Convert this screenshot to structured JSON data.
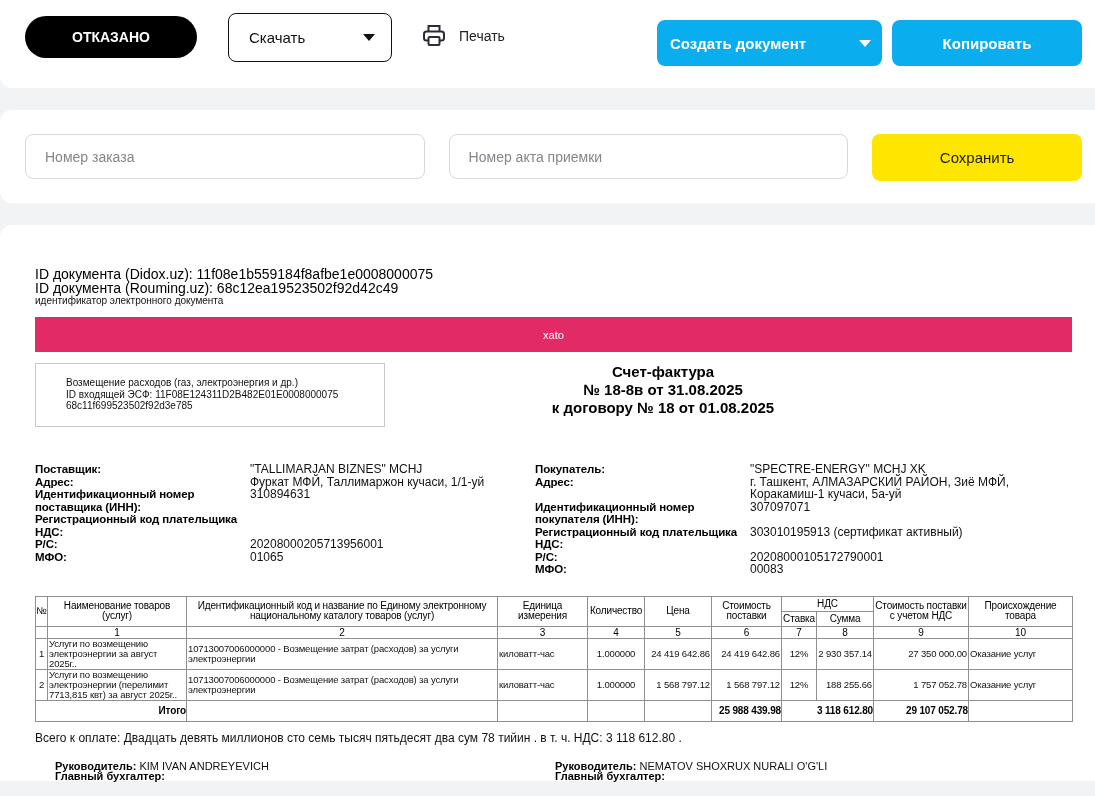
{
  "toolbar": {
    "status": {
      "label": "ОТКАЗАНО"
    },
    "download": {
      "label": "Скачать"
    },
    "print": {
      "label": "Печать"
    },
    "create": {
      "label": "Создать документ"
    },
    "copy": {
      "label": "Копировать"
    }
  },
  "form": {
    "fields": [
      {
        "placeholder": "Номер заказа"
      },
      {
        "placeholder": "Номер акта приемки"
      }
    ],
    "save": {
      "label": "Сохранить"
    }
  },
  "document": {
    "ids": [
      "ID документа (Didox.uz): 11f08e1b559184f8afbe1e0008000075",
      "ID документа (Rouming.uz): 68c12ea19523502f92d42c49"
    ],
    "id_caption": "идентификатор электронного документа",
    "banner": "xato",
    "info_box": [
      "Возмещение расходов (газ, электроэнергия и др.)",
      "ID входящей ЭСФ: 11F08E124311D2B482E01E0008000075",
      "68c11f699523502f92d3e785"
    ],
    "title": [
      "Счет-фактура",
      "№ 18-8в от 31.08.2025",
      "к договору № 18 от 01.08.2025"
    ],
    "parties": [
      {
        "rows": [
          {
            "label": "Поставщик:",
            "value": "\"TALLIMARJAN BIZNES\" MCHJ"
          },
          {
            "label": "Адрес:",
            "value": "Фуркат МФЙ, Таллимаржон кучаси, 1/1-уй"
          },
          {
            "label": "Идентификационный номер поставщика (ИНН):",
            "value": "310894631"
          },
          {
            "label": "Регистрационный код плательщика НДС:"
          },
          {
            "label": "Р/С:",
            "value": "20208000205713956001"
          },
          {
            "label": "МФО:",
            "value": "01065"
          }
        ]
      },
      {
        "rows": [
          {
            "label": "Покупатель:",
            "value": "\"SPECTRE-ENERGY\" MCHJ XK"
          },
          {
            "label": "Адрес:",
            "value": "г. Ташкент, АЛМАЗАРСКИЙ РАЙОН, Зиё МФЙ, Коракамиш-1 кучаси, 5а-уй"
          },
          {
            "label": "Идентификационный номер покупателя (ИНН):",
            "value": "307097071"
          },
          {
            "label": "Регистрационный код плательщика НДС:",
            "value": "303010195913 (сертификат активный)"
          },
          {
            "label": "Р/С:",
            "value": "20208000105172790001"
          },
          {
            "label": "МФО:",
            "value": "00083"
          }
        ]
      }
    ],
    "table": {
      "columns": [
        {
          "label": "№"
        },
        {
          "label": "Наименование товаров (услуг)",
          "number": "1"
        },
        {
          "label": "Идентификационный код и название по Единому электронному национальному каталогу товаров (услуг)",
          "number": "2"
        },
        {
          "label": "Единица измерения",
          "number": "3"
        },
        {
          "label": "Количество",
          "number": "4"
        },
        {
          "label": "Цена",
          "number": "5"
        },
        {
          "label": "Стоимость поставки",
          "number": "6"
        },
        {
          "label": "НДС",
          "colspan": 2,
          "children": [
            {
              "label": "Ставка",
              "number": "7"
            },
            {
              "label": "Сумма",
              "number": "8"
            }
          ]
        },
        {
          "label": "Стоимость поставки с учетом НДС",
          "number": "9"
        },
        {
          "label": "Происхождение товара",
          "number": "10"
        }
      ],
      "rows": [
        [
          "1",
          "Услуги по возмещению электроэнергии за август 2025г..",
          "10713007006000000 - Возмещение затрат (расходов) за услуги электроэнергии",
          "киловатт-час",
          "1.000000",
          "24 419 642.86",
          "24 419 642.86",
          "12%",
          "2 930 357.14",
          "27 350 000.00",
          "Оказание услуг"
        ],
        [
          "2",
          "Услуги по возмещению электроэнергии (перелимит 7713,815 квт) за август 2025г..",
          "10713007006000000 - Возмещение затрат (расходов) за услуги электроэнергии",
          "киловатт-час",
          "1.000000",
          "1 568 797.12",
          "1 568 797.12",
          "12%",
          "188 255.66",
          "1 757 052.78",
          "Оказание услуг"
        ]
      ],
      "total": {
        "label": "Итого",
        "cost": "25 988 439.98",
        "vat_sum": "3 118 612.80",
        "cost_with_vat": "29 107 052.78"
      }
    },
    "total_text": "Всего к оплате: Двадцать девять миллионов сто семь тысяч пятьдесят два сум 78 тийин . в т. ч. НДС: 3 118 612.80 .",
    "signatures": [
      [
        {
          "label": "Руководитель:",
          "value": "KIM IVAN ANDREYEVICH"
        },
        {
          "label": "Главный бухгалтер:"
        }
      ],
      [
        {
          "label": "Руководитель:",
          "value": "NEMATOV SHOXRUX NURALI O'G'LI"
        },
        {
          "label": "Главный бухгалтер:"
        }
      ]
    ]
  }
}
